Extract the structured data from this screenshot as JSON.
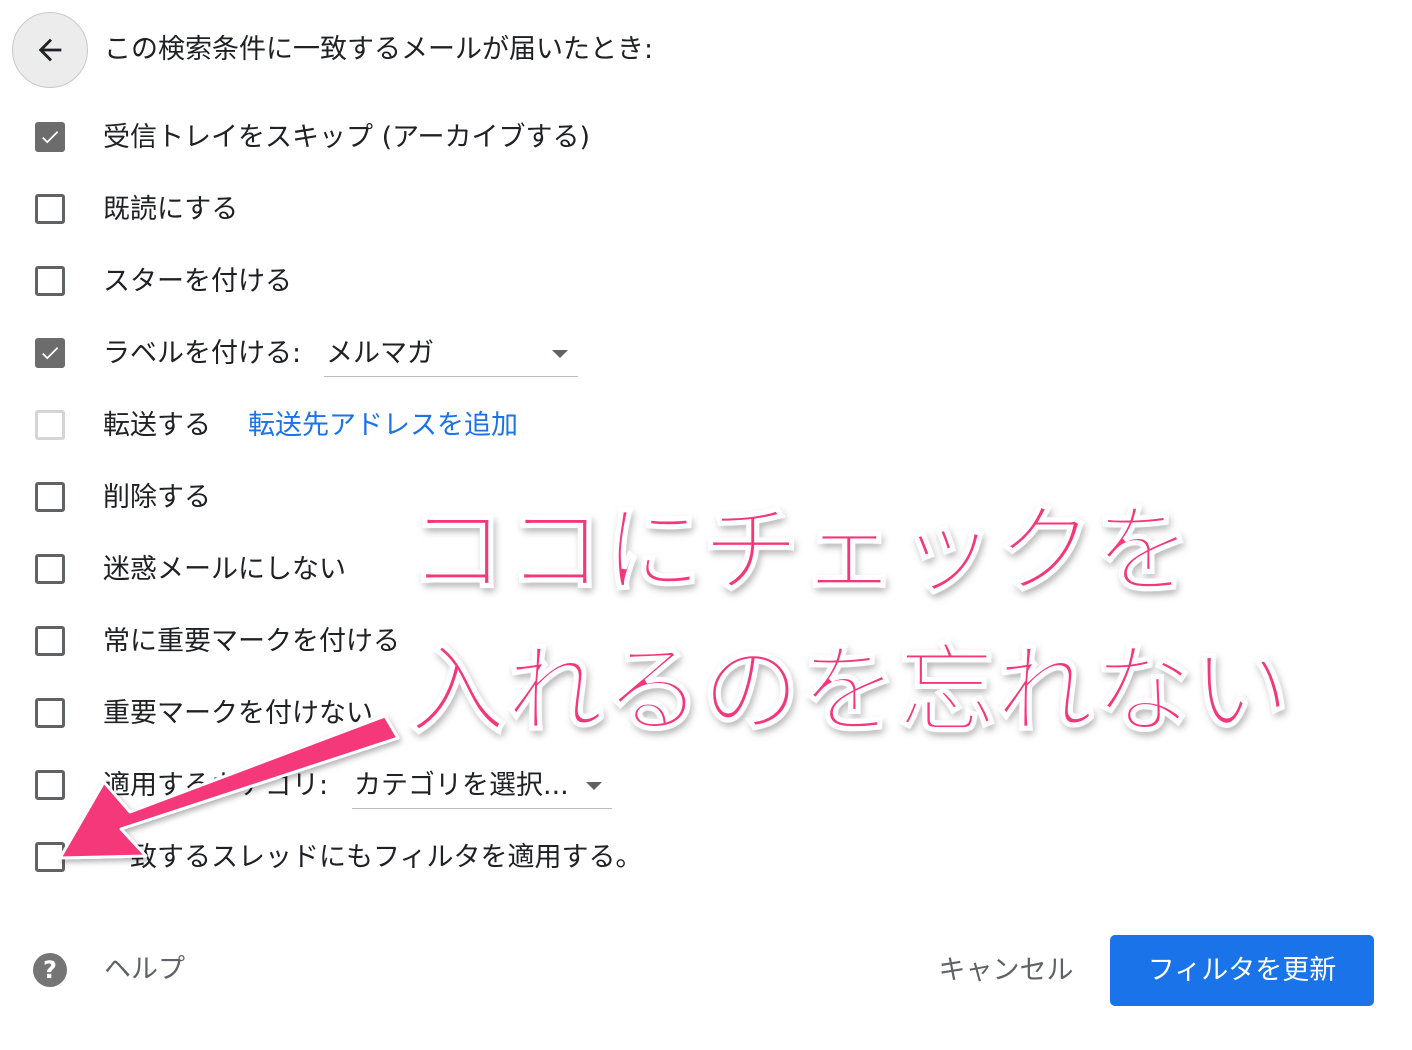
{
  "header": {
    "title": "この検索条件に一致するメールが届いたとき:"
  },
  "options": [
    {
      "label": "受信トレイをスキップ (アーカイブする)",
      "checked": true
    },
    {
      "label": "既読にする",
      "checked": false
    },
    {
      "label": "スターを付ける",
      "checked": false
    },
    {
      "label": "ラベルを付ける:",
      "checked": true,
      "select": "メルマガ"
    },
    {
      "label": "転送する",
      "checked": false,
      "disabled": true,
      "link": "転送先アドレスを追加"
    },
    {
      "label": "削除する",
      "checked": false
    },
    {
      "label": "迷惑メールにしない",
      "checked": false
    },
    {
      "label": "常に重要マークを付ける",
      "checked": false
    },
    {
      "label": "重要マークを付けない",
      "checked": false
    },
    {
      "label": "適用するカテゴリ:",
      "checked": false,
      "select": "カテゴリを選択..."
    },
    {
      "label": "一致するスレッドにもフィルタを適用する。",
      "checked": false
    }
  ],
  "footer": {
    "help": "ヘルプ",
    "help_icon": "?",
    "cancel": "キャンセル",
    "update": "フィルタを更新"
  },
  "annotation": {
    "line1": "ココにチェックを",
    "line2": "入れるのを忘れない",
    "color": "#f5377a"
  },
  "colors": {
    "accent": "#1a73e8",
    "checked": "#6c6c6c"
  }
}
